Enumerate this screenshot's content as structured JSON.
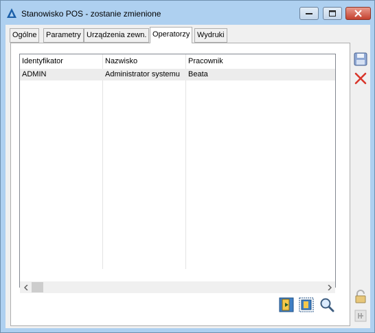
{
  "window": {
    "title": "Stanowisko POS - zostanie zmienione"
  },
  "tabs": [
    {
      "label": "Ogólne"
    },
    {
      "label": "Parametry"
    },
    {
      "label": "Urządzenia zewn."
    },
    {
      "label": "Operatorzy"
    },
    {
      "label": "Wydruki"
    }
  ],
  "active_tab": "Operatorzy",
  "table": {
    "columns": [
      "Identyfikator",
      "Nazwisko",
      "Pracownik"
    ],
    "rows": [
      [
        "ADMIN",
        "Administrator systemu",
        "Beata"
      ]
    ]
  },
  "colors": {
    "titlebar": "#aed0f0",
    "close_button": "#c4412f",
    "selected_row": "#ececec"
  }
}
